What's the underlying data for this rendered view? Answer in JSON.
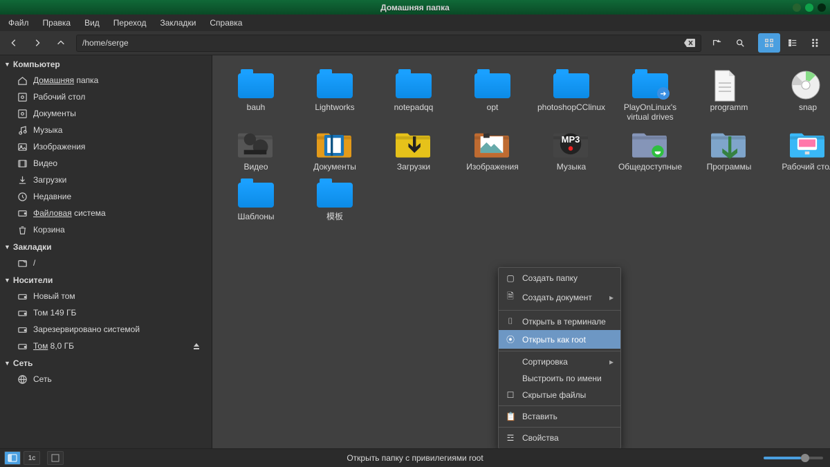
{
  "window": {
    "title": "Домашняя папка"
  },
  "menu": {
    "file": "Файл",
    "edit": "Правка",
    "view": "Вид",
    "go": "Переход",
    "bookmarks": "Закладки",
    "help": "Справка"
  },
  "toolbar": {
    "path": "/home/serge"
  },
  "sidebar": {
    "sections": {
      "computer": "Компьютер",
      "bookmarks": "Закладки",
      "media": "Носители",
      "network": "Сеть"
    },
    "computer": [
      {
        "icon": "home",
        "label": "Домашняя папка",
        "accesskey": "Д",
        "ul": true
      },
      {
        "icon": "disk",
        "label": "Рабочий стол"
      },
      {
        "icon": "disk",
        "label": "Документы"
      },
      {
        "icon": "music",
        "label": "Музыка"
      },
      {
        "icon": "image",
        "label": "Изображения"
      },
      {
        "icon": "video",
        "label": "Видео"
      },
      {
        "icon": "download",
        "label": "Загрузки"
      },
      {
        "icon": "clock",
        "label": "Недавние"
      },
      {
        "icon": "fs",
        "label": "Файловая система",
        "accesskey": "Ф",
        "ul": true
      },
      {
        "icon": "trash",
        "label": "Корзина"
      }
    ],
    "bookmarks": [
      {
        "icon": "bookmark",
        "label": "/"
      }
    ],
    "media": [
      {
        "icon": "drive",
        "label": "Новый том"
      },
      {
        "icon": "drive",
        "label": "Том 149 ГБ"
      },
      {
        "icon": "drive",
        "label": "Зарезервировано системой"
      },
      {
        "icon": "drive",
        "label": "Том 8,0 ГБ",
        "accesskey": "Т",
        "ul": true,
        "eject": true
      }
    ],
    "network": [
      {
        "icon": "network",
        "label": "Сеть"
      }
    ]
  },
  "files": [
    {
      "name": "bauh",
      "type": "folder"
    },
    {
      "name": "Lightworks",
      "type": "folder"
    },
    {
      "name": "notepadqq",
      "type": "folder"
    },
    {
      "name": "opt",
      "type": "folder"
    },
    {
      "name": "photoshopCClinux",
      "type": "folder"
    },
    {
      "name": "PlayOnLinux's virtual drives",
      "type": "folder",
      "badge": "link"
    },
    {
      "name": "programm",
      "type": "document"
    },
    {
      "name": "snap",
      "type": "disc"
    },
    {
      "name": "Видео",
      "type": "xvideo"
    },
    {
      "name": "Документы",
      "type": "xdocs"
    },
    {
      "name": "Загрузки",
      "type": "xdl"
    },
    {
      "name": "Изображения",
      "type": "ximg"
    },
    {
      "name": "Музыка",
      "type": "xmusic"
    },
    {
      "name": "Общедоступные",
      "type": "xpublic"
    },
    {
      "name": "Программы",
      "type": "xprogs"
    },
    {
      "name": "Рабочий стол",
      "type": "xdesktop"
    },
    {
      "name": "Шаблоны",
      "type": "folder"
    },
    {
      "name": "模板",
      "type": "folder"
    }
  ],
  "context": {
    "create_folder": "Создать папку",
    "create_doc": "Создать документ",
    "open_terminal": "Открыть в терминале",
    "open_root": "Открыть как root",
    "sort": "Сортировка",
    "arrange": "Выстроить по имени",
    "hidden": "Скрытые файлы",
    "paste": "Вставить",
    "properties": "Свойства"
  },
  "statusbar": {
    "text": "Открыть папку с привилегиями root",
    "tc": "1c"
  }
}
